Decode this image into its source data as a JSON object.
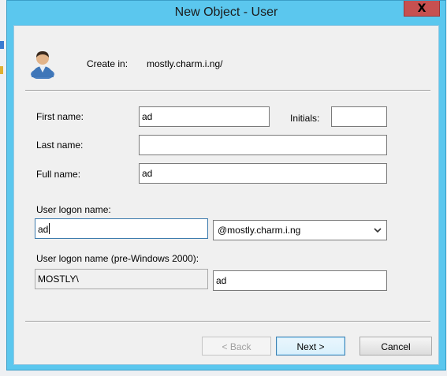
{
  "window": {
    "title": "New Object - User",
    "close_glyph": "X"
  },
  "header": {
    "icon": "user-icon",
    "create_in_label": "Create in:",
    "create_in_path": "mostly.charm.i.ng/"
  },
  "form": {
    "first_name": {
      "label": "First name:",
      "value": "ad"
    },
    "initials": {
      "label": "Initials:",
      "value": ""
    },
    "last_name": {
      "label": "Last name:",
      "value": ""
    },
    "full_name": {
      "label": "Full name:",
      "value": "ad"
    },
    "logon_name": {
      "label": "User logon name:",
      "value": "ad"
    },
    "upn_suffix": {
      "selected": "@mostly.charm.i.ng",
      "icon": "chevron-down-icon"
    },
    "pre2000": {
      "label": "User logon name (pre-Windows 2000):",
      "domain": "MOSTLY\\",
      "value": "ad"
    }
  },
  "buttons": {
    "back": "< Back",
    "next": "Next >",
    "cancel": "Cancel"
  },
  "colors": {
    "frame": "#5bc7ee",
    "close_button": "#c75050",
    "client_background": "#f0f0f0",
    "default_button_border": "#3c7fb1"
  }
}
